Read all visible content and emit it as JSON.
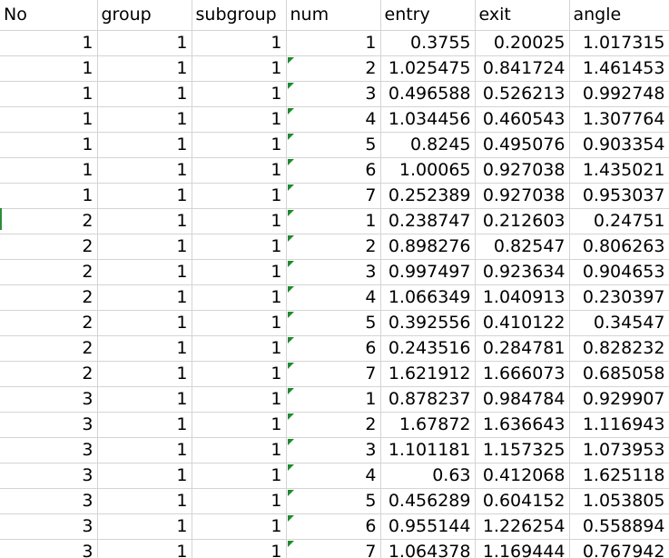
{
  "headers": [
    "No",
    "group",
    "subgroup",
    "num",
    "entry",
    "exit",
    "angle"
  ],
  "rows": [
    [
      "1",
      "1",
      "1",
      "1",
      "0.3755",
      "0.20025",
      "1.017315"
    ],
    [
      "1",
      "1",
      "1",
      "2",
      "1.025475",
      "0.841724",
      "1.461453"
    ],
    [
      "1",
      "1",
      "1",
      "3",
      "0.496588",
      "0.526213",
      "0.992748"
    ],
    [
      "1",
      "1",
      "1",
      "4",
      "1.034456",
      "0.460543",
      "1.307764"
    ],
    [
      "1",
      "1",
      "1",
      "5",
      "0.8245",
      "0.495076",
      "0.903354"
    ],
    [
      "1",
      "1",
      "1",
      "6",
      "1.00065",
      "0.927038",
      "1.435021"
    ],
    [
      "1",
      "1",
      "1",
      "7",
      "0.252389",
      "0.927038",
      "0.953037"
    ],
    [
      "2",
      "1",
      "1",
      "1",
      "0.238747",
      "0.212603",
      "0.24751"
    ],
    [
      "2",
      "1",
      "1",
      "2",
      "0.898276",
      "0.82547",
      "0.806263"
    ],
    [
      "2",
      "1",
      "1",
      "3",
      "0.997497",
      "0.923634",
      "0.904653"
    ],
    [
      "2",
      "1",
      "1",
      "4",
      "1.066349",
      "1.040913",
      "0.230397"
    ],
    [
      "2",
      "1",
      "1",
      "5",
      "0.392556",
      "0.410122",
      "0.34547"
    ],
    [
      "2",
      "1",
      "1",
      "6",
      "0.243516",
      "0.284781",
      "0.828232"
    ],
    [
      "2",
      "1",
      "1",
      "7",
      "1.621912",
      "1.666073",
      "0.685058"
    ],
    [
      "3",
      "1",
      "1",
      "1",
      "0.878237",
      "0.984784",
      "0.929907"
    ],
    [
      "3",
      "1",
      "1",
      "2",
      "1.67872",
      "1.636643",
      "1.116943"
    ],
    [
      "3",
      "1",
      "1",
      "3",
      "1.101181",
      "1.157325",
      "1.073953"
    ],
    [
      "3",
      "1",
      "1",
      "4",
      "0.63",
      "0.412068",
      "1.625118"
    ],
    [
      "3",
      "1",
      "1",
      "5",
      "0.456289",
      "0.604152",
      "1.053805"
    ],
    [
      "3",
      "1",
      "1",
      "6",
      "0.955144",
      "1.226254",
      "0.558894"
    ],
    [
      "3",
      "1",
      "1",
      "7",
      "1.064378",
      "1.169444",
      "0.767942"
    ]
  ],
  "flags": {
    "number_stored_as_text_rows": [
      1,
      2,
      3,
      4,
      5,
      6,
      7,
      8,
      9,
      10,
      11,
      12,
      13,
      14,
      15,
      16,
      17,
      18,
      19,
      20
    ],
    "flag_color": "#1f8a2e"
  }
}
